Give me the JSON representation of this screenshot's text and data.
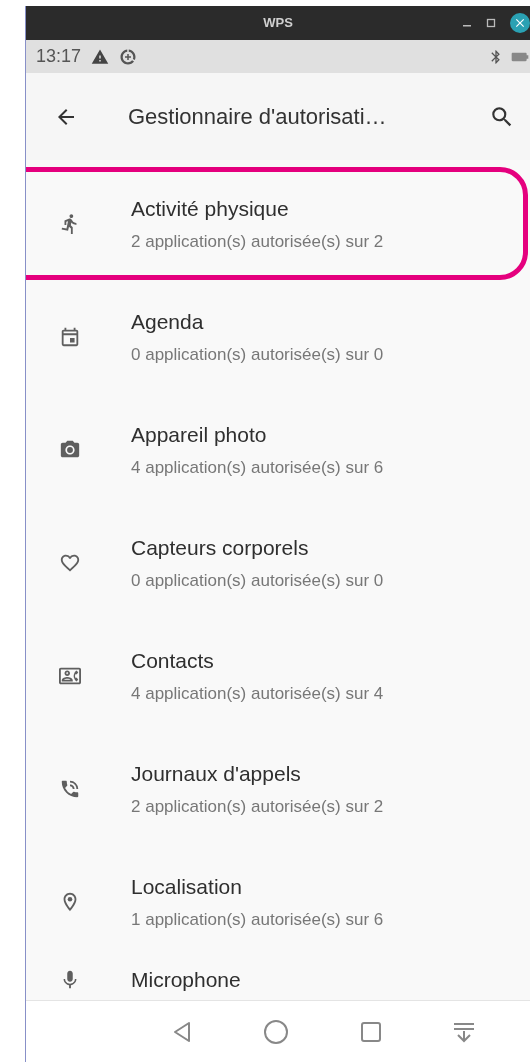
{
  "window": {
    "title": "WPS"
  },
  "status_bar": {
    "time": "13:17"
  },
  "app_bar": {
    "title": "Gestionnaire d'autorisati…"
  },
  "permissions": [
    {
      "name": "Activité physique",
      "summary": "2 application(s) autorisée(s) sur 2",
      "highlighted": true
    },
    {
      "name": "Agenda",
      "summary": "0 application(s) autorisée(s) sur 0",
      "highlighted": false
    },
    {
      "name": "Appareil photo",
      "summary": "4 application(s) autorisée(s) sur 6",
      "highlighted": false
    },
    {
      "name": "Capteurs corporels",
      "summary": "0 application(s) autorisée(s) sur 0",
      "highlighted": false
    },
    {
      "name": "Contacts",
      "summary": "4 application(s) autorisée(s) sur 4",
      "highlighted": false
    },
    {
      "name": "Journaux d'appels",
      "summary": "2 application(s) autorisée(s) sur 2",
      "highlighted": false
    },
    {
      "name": "Localisation",
      "summary": "1 application(s) autorisée(s) sur 6",
      "highlighted": false
    },
    {
      "name": "Microphone",
      "highlighted": false
    }
  ]
}
